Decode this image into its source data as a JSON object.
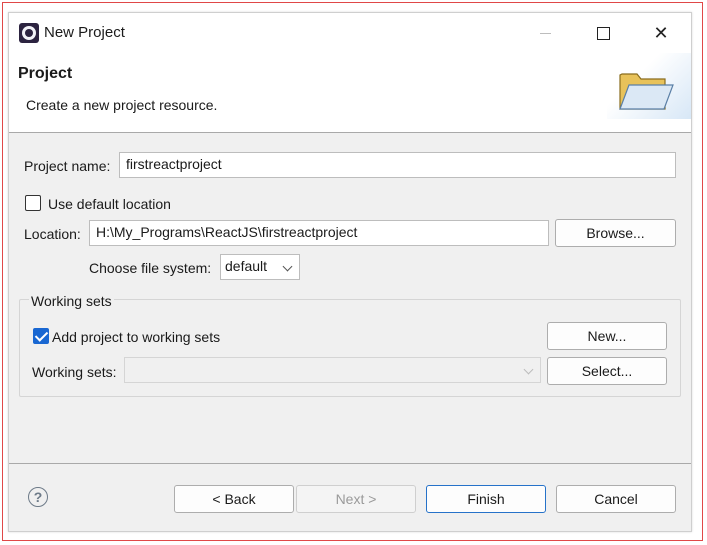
{
  "window": {
    "title": "New Project",
    "close_glyph": "✕"
  },
  "banner": {
    "title": "Project",
    "description": "Create a new project resource."
  },
  "form": {
    "project_name_label": "Project name:",
    "project_name_value": "firstreactproject",
    "use_default_location_label": "Use default location",
    "use_default_location_checked": false,
    "location_label": "Location:",
    "location_value": "H:\\My_Programs\\ReactJS\\firstreactproject",
    "browse_label": "Browse...",
    "file_system_label": "Choose file system:",
    "file_system_value": "default"
  },
  "working_sets": {
    "group_label": "Working sets",
    "add_to_sets_label": "Add project to working sets",
    "add_to_sets_checked": true,
    "new_label": "New...",
    "sets_label": "Working sets:",
    "sets_value": "",
    "select_label": "Select..."
  },
  "footer": {
    "help_glyph": "?",
    "back_label": "< Back",
    "next_label": "Next >",
    "finish_label": "Finish",
    "cancel_label": "Cancel"
  },
  "colors": {
    "accent": "#1967d2",
    "dialog_bg": "#f0f0f0",
    "frame_highlight": "#e04848"
  }
}
